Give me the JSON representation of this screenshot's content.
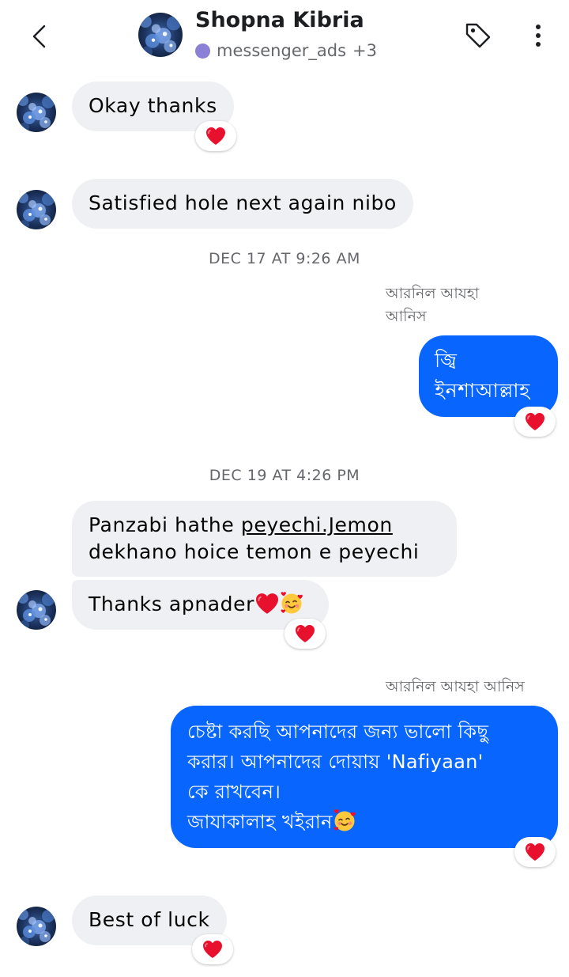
{
  "header": {
    "title": "Shopna Kibria",
    "subtitle_label": "messenger_ads",
    "subtitle_count": "+3",
    "subtitle_dot_color": "#8b7fd6",
    "back_icon": "chevron-left-icon",
    "tag_icon": "tag-icon",
    "more_icon": "more-vertical-icon"
  },
  "colors": {
    "outgoing_bubble": "#0866ff",
    "incoming_bubble": "#eff0f3",
    "reaction_heart": "#e8112d"
  },
  "messages": {
    "m1": {
      "text": "Okay thanks",
      "reaction": "heart-icon"
    },
    "m2": {
      "text": "Satisfied  hole next again nibo"
    },
    "ts1": "DEC 17 AT 9:26 AM",
    "m3": {
      "sender_line1": "আরনিল আযহা",
      "sender_line2": "আনিস",
      "line1": "জ্বি",
      "line2": "ইনশাআল্লাহ",
      "reaction": "heart-icon"
    },
    "ts2": "DEC 19 AT 4:26 PM",
    "m4": {
      "line1_a": "Panzabi hathe ",
      "line1_link": "peyechi.Jemon",
      "line2": "dekhano hoice temon e peyechi"
    },
    "m5": {
      "text": "Thanks apnader",
      "emojis": [
        "heart-emoji",
        "smiling-face-with-hearts-emoji"
      ],
      "reaction": "heart-icon"
    },
    "m6": {
      "sender": "আরনিল আযহা আনিস",
      "line1": "চেষ্টা করছি আপনাদের জন্য ভালো কিছু",
      "line2": "করার। আপনাদের দোয়ায় 'Nafiyaan'",
      "line3": "কে রাখবেন।",
      "line4": "জাযাকালাহ খইরান",
      "emoji": "smiling-face-with-hearts-emoji",
      "reaction": "heart-icon"
    },
    "m7": {
      "text": "Best of luck",
      "reaction": "heart-icon"
    }
  }
}
